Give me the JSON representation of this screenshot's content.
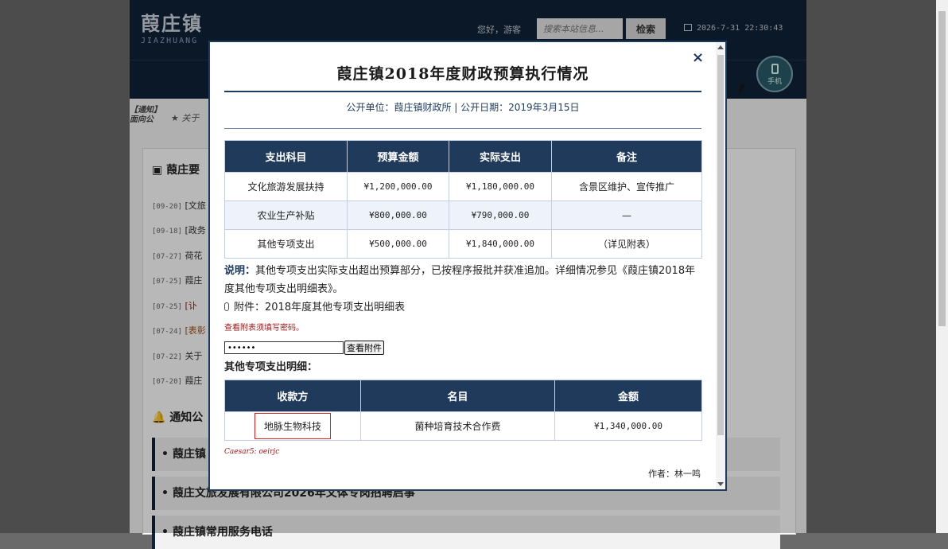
{
  "site": {
    "logo_title": "葭庄镇",
    "logo_sub": "JIAZHUANG",
    "greeting": "您好，游客",
    "search_placeholder": "搜索本站信息...",
    "search_button": "检索",
    "datetime": "2026-7-31 22:30:43",
    "mobile_label": "手机"
  },
  "notice": {
    "tag": "【通知】",
    "tag_prefix": "面向公",
    "text": "★ 关于"
  },
  "sections": {
    "news_title": "葭庄要",
    "news": [
      {
        "date": "[09-20]",
        "title": "[文旅"
      },
      {
        "date": "[09-18]",
        "title": "[政务"
      },
      {
        "date": "[07-27]",
        "title": "荷花"
      },
      {
        "date": "[07-25]",
        "title": "葭庄"
      },
      {
        "date": "[07-25]",
        "title": "[讣"
      },
      {
        "date": "[07-24]",
        "title": "[表彰"
      },
      {
        "date": "[07-22]",
        "title": "关于"
      },
      {
        "date": "[07-20]",
        "title": "葭庄"
      }
    ],
    "notice_title": "通知公",
    "notices": [
      "• 葭庄镇",
      "• 葭庄文旅发展有限公司2026年文体专岗招聘启事",
      "• 葭庄镇常用服务电话"
    ]
  },
  "modal": {
    "title": "葭庄镇2018年度财政预算执行情况",
    "meta": "公开单位：葭庄镇财政所 | 公开日期：2019年3月15日",
    "close_symbol": "×",
    "table1": {
      "headers": [
        "支出科目",
        "预算金额",
        "实际支出",
        "备注"
      ],
      "rows": [
        [
          "文化旅游发展扶持",
          "¥1,200,000.00",
          "¥1,180,000.00",
          "含景区维护、宣传推广"
        ],
        [
          "农业生产补贴",
          "¥800,000.00",
          "¥790,000.00",
          "—"
        ],
        [
          "其他专项支出",
          "¥500,000.00",
          "¥1,840,000.00",
          "（详见附表）"
        ]
      ]
    },
    "desc_label": "说明：",
    "desc_text": "其他专项支出实际支出超出预算部分，已按程序报批并获准追加。详细情况参见《葭庄镇2018年度其他专项支出明细表》。",
    "attachment": "附件：2018年度其他专项支出明细表",
    "password_hint": "查看附表须填写密码。",
    "password_value": "••••••",
    "view_button": "查看附件",
    "detail_title": "其他专项支出明细：",
    "table2": {
      "headers": [
        "收款方",
        "名目",
        "金额"
      ],
      "rows": [
        [
          "地脉生物科技",
          "菌种培育技术合作费",
          "¥1,340,000.00"
        ]
      ]
    },
    "cipher": "Caesar5: oeirjc",
    "author": "作者：林一鸣"
  }
}
